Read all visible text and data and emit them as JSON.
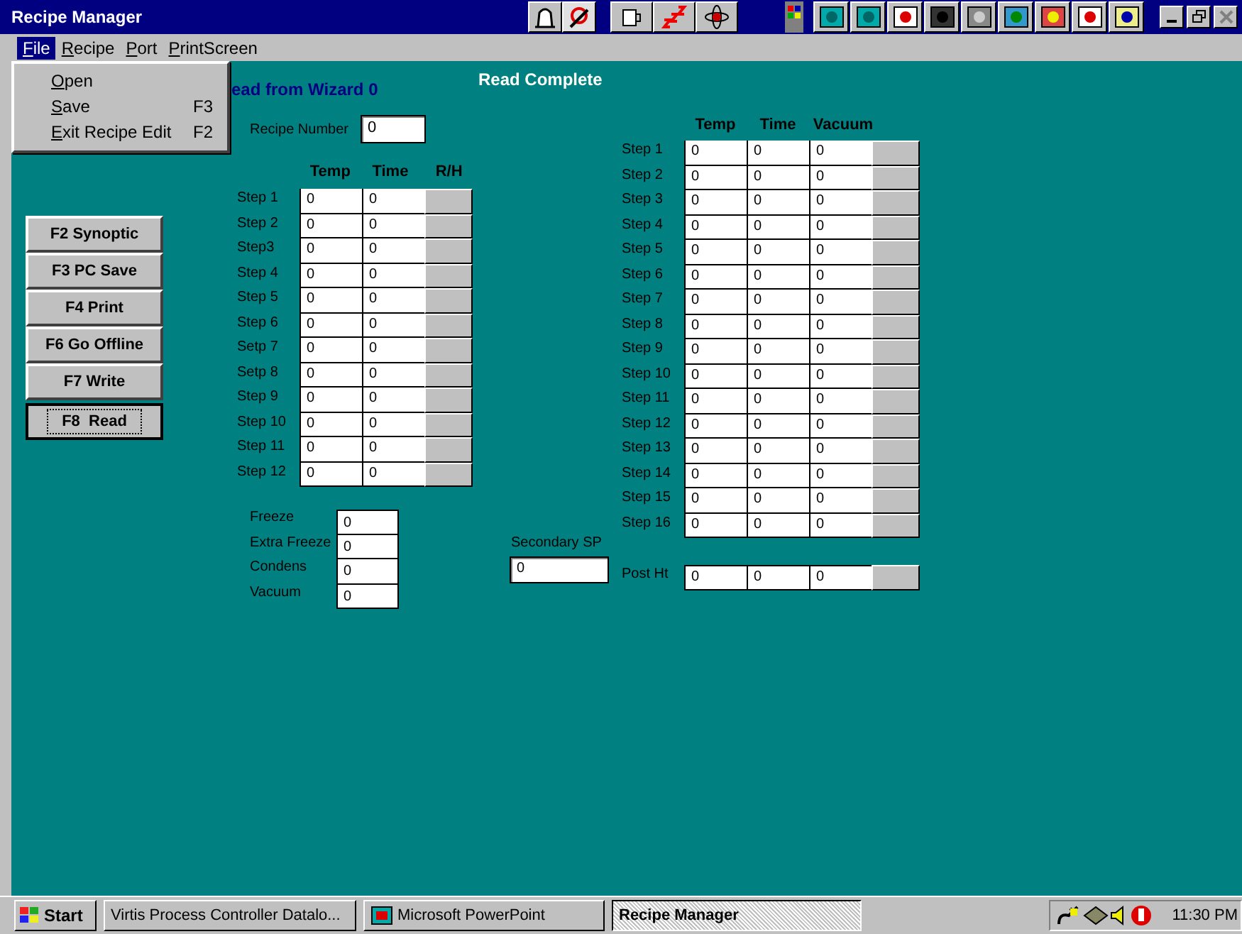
{
  "window": {
    "title": "Recipe Manager"
  },
  "menu": [
    {
      "access": "F",
      "rest": "ile",
      "selected": true
    },
    {
      "access": "R",
      "rest": "ecipe",
      "selected": false
    },
    {
      "access": "P",
      "rest": "ort",
      "selected": false
    },
    {
      "access": "P",
      "rest": "rintScreen",
      "selected": false
    }
  ],
  "file_menu": [
    {
      "access": "O",
      "rest": "pen"
    },
    {
      "access": "S",
      "rest": "ave",
      "shortcut": "F3"
    },
    {
      "access": "E",
      "rest": "xit Recipe Edit",
      "shortcut": "F2"
    }
  ],
  "wizard_status": "ead from Wizard 0",
  "read_status": "Read Complete",
  "function_buttons": [
    {
      "label": "F2 Synoptic",
      "default": false
    },
    {
      "label": "F3 PC Save",
      "default": false
    },
    {
      "label": "F4 Print",
      "default": false
    },
    {
      "label": "F6 Go Offline",
      "default": false
    },
    {
      "label": "F7 Write",
      "default": false
    },
    {
      "label": "F8  Read",
      "default": true
    }
  ],
  "recipe_number": {
    "label": "Recipe Number",
    "value": "0"
  },
  "freeze_steps": {
    "columns": [
      "Temp",
      "Time",
      "R/H"
    ],
    "rows": [
      {
        "label": "Step 1",
        "values": [
          "0",
          "0"
        ]
      },
      {
        "label": "Step 2",
        "values": [
          "0",
          "0"
        ]
      },
      {
        "label": "Step3",
        "values": [
          "0",
          "0"
        ]
      },
      {
        "label": "Step 4",
        "values": [
          "0",
          "0"
        ]
      },
      {
        "label": "Step 5",
        "values": [
          "0",
          "0"
        ]
      },
      {
        "label": "Step 6",
        "values": [
          "0",
          "0"
        ]
      },
      {
        "label": "Setp 7",
        "values": [
          "0",
          "0"
        ]
      },
      {
        "label": "Setp 8",
        "values": [
          "0",
          "0"
        ]
      },
      {
        "label": "Step 9",
        "values": [
          "0",
          "0"
        ]
      },
      {
        "label": "Step 10",
        "values": [
          "0",
          "0"
        ]
      },
      {
        "label": "Step 11",
        "values": [
          "0",
          "0"
        ]
      },
      {
        "label": "Step 12",
        "values": [
          "0",
          "0"
        ]
      }
    ]
  },
  "settings": [
    {
      "label": "Freeze",
      "value": "0"
    },
    {
      "label": "Extra Freeze",
      "value": "0"
    },
    {
      "label": "Condens",
      "value": "0"
    },
    {
      "label": "Vacuum",
      "value": "0"
    }
  ],
  "secondary_sp": {
    "label": "Secondary SP",
    "value": "0"
  },
  "drying_steps": {
    "columns": [
      "Temp",
      "Time",
      "Vacuum"
    ],
    "rows": [
      {
        "label": "Step 1",
        "values": [
          "0",
          "0",
          "0"
        ]
      },
      {
        "label": "Step 2",
        "values": [
          "0",
          "0",
          "0"
        ]
      },
      {
        "label": "Step 3",
        "values": [
          "0",
          "0",
          "0"
        ]
      },
      {
        "label": "Step 4",
        "values": [
          "0",
          "0",
          "0"
        ]
      },
      {
        "label": "Step 5",
        "values": [
          "0",
          "0",
          "0"
        ]
      },
      {
        "label": "Step 6",
        "values": [
          "0",
          "0",
          "0"
        ]
      },
      {
        "label": "Step 7",
        "values": [
          "0",
          "0",
          "0"
        ]
      },
      {
        "label": "Step 8",
        "values": [
          "0",
          "0",
          "0"
        ]
      },
      {
        "label": "Step 9",
        "values": [
          "0",
          "0",
          "0"
        ]
      },
      {
        "label": "Step 10",
        "values": [
          "0",
          "0",
          "0"
        ]
      },
      {
        "label": "Step 11",
        "values": [
          "0",
          "0",
          "0"
        ]
      },
      {
        "label": "Step 12",
        "values": [
          "0",
          "0",
          "0"
        ]
      },
      {
        "label": "Step 13",
        "values": [
          "0",
          "0",
          "0"
        ]
      },
      {
        "label": "Step 14",
        "values": [
          "0",
          "0",
          "0"
        ]
      },
      {
        "label": "Step 15",
        "values": [
          "0",
          "0",
          "0"
        ]
      },
      {
        "label": "Step 16",
        "values": [
          "0",
          "0",
          "0"
        ]
      }
    ],
    "post_heat": {
      "label": "Post Ht",
      "values": [
        "0",
        "0",
        "0"
      ]
    }
  },
  "taskbar": {
    "start": "Start",
    "tasks": [
      {
        "label": "Virtis Process Controller Datalo...",
        "selected": false,
        "kind": "plain"
      },
      {
        "label": "Microsoft PowerPoint",
        "selected": false,
        "kind": "icon"
      },
      {
        "label": "Recipe Manager",
        "selected": true,
        "kind": "plain"
      }
    ],
    "clock": "11:30 PM"
  }
}
